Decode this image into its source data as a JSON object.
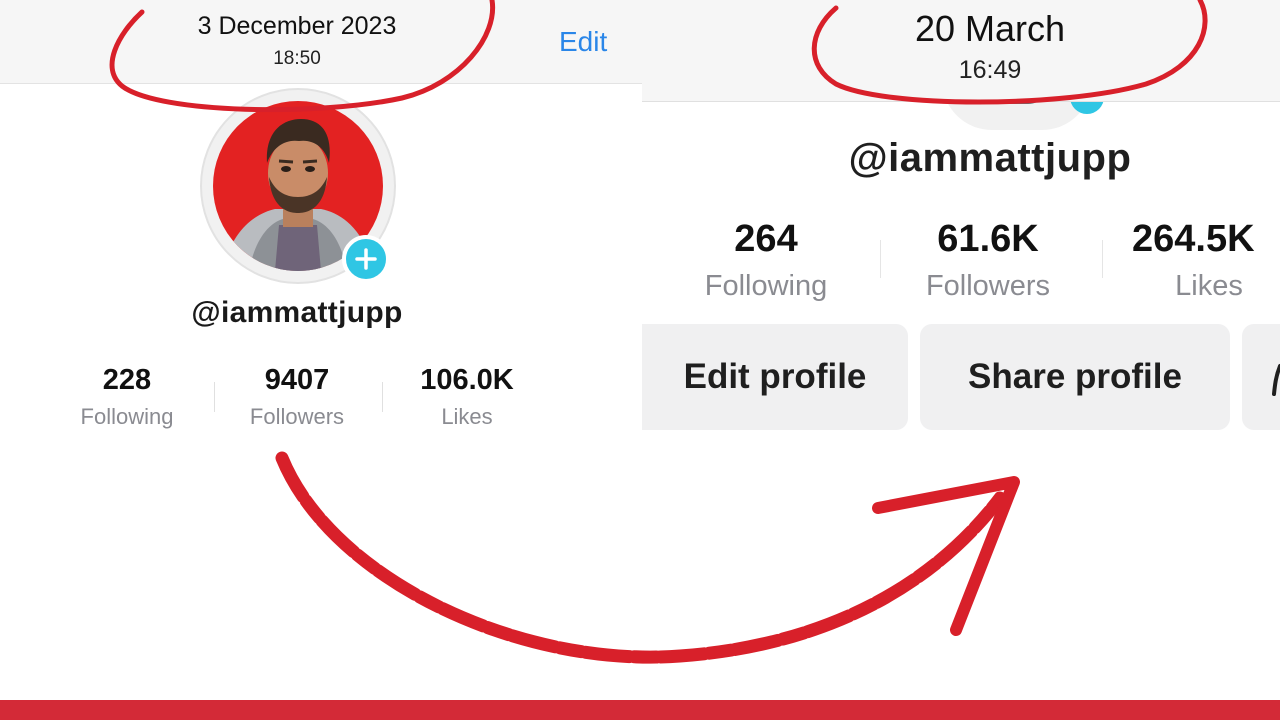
{
  "left_screen": {
    "header": {
      "date": "3 December 2023",
      "time": "18:50",
      "edit_label": "Edit"
    },
    "profile": {
      "username": "@iammattjupp"
    },
    "stats": [
      {
        "value": "228",
        "label": "Following"
      },
      {
        "value": "9407",
        "label": "Followers"
      },
      {
        "value": "106.0K",
        "label": "Likes"
      }
    ]
  },
  "right_screen": {
    "header": {
      "date": "20 March",
      "time": "16:49"
    },
    "profile": {
      "username": "@iammattjupp"
    },
    "stats": [
      {
        "value": "264",
        "label": "Following"
      },
      {
        "value": "61.6K",
        "label": "Followers"
      },
      {
        "value": "264.5K",
        "label": "Likes"
      }
    ],
    "buttons": {
      "edit_profile": "Edit profile",
      "share_profile": "Share profile"
    }
  },
  "colors": {
    "annotation_red": "#d8202a",
    "link_blue": "#2a86e8",
    "avatar_background": "#e32222",
    "add_badge": "#2fc6e4",
    "muted_text": "#8a8b91",
    "button_bg": "#f0f0f1"
  },
  "icons": [
    "plus-icon",
    "add-friend-icon"
  ]
}
